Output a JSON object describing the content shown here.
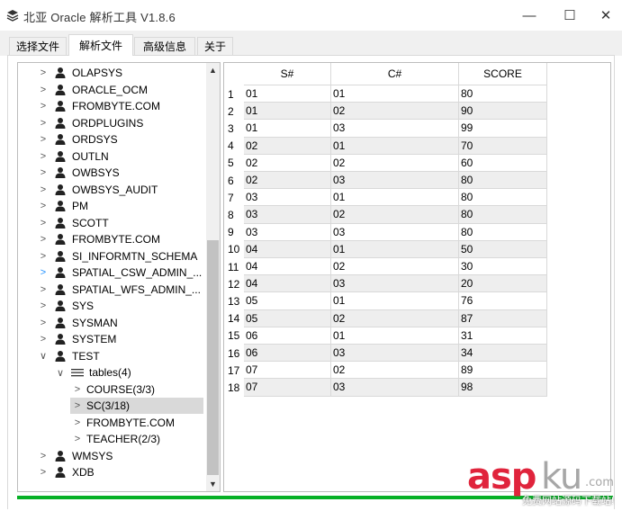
{
  "window": {
    "title": "北亚 Oracle 解析工具  V1.8.6",
    "minimize_glyph": "—",
    "maximize_glyph": "☐",
    "close_glyph": "✕",
    "icon": "layers-icon"
  },
  "tabs": [
    {
      "label": "选择文件",
      "active": false
    },
    {
      "label": "解析文件",
      "active": true
    },
    {
      "label": "高级信息",
      "active": false
    },
    {
      "label": "关于",
      "active": false
    }
  ],
  "tree": {
    "items": [
      {
        "label": "OLAPSYS",
        "type": "user",
        "chevron": ">"
      },
      {
        "label": "ORACLE_OCM",
        "type": "user",
        "chevron": ">"
      },
      {
        "label": "FROMBYTE.COM",
        "type": "user",
        "chevron": ">"
      },
      {
        "label": "ORDPLUGINS",
        "type": "user",
        "chevron": ">"
      },
      {
        "label": "ORDSYS",
        "type": "user",
        "chevron": ">"
      },
      {
        "label": "OUTLN",
        "type": "user",
        "chevron": ">"
      },
      {
        "label": "OWBSYS",
        "type": "user",
        "chevron": ">"
      },
      {
        "label": "OWBSYS_AUDIT",
        "type": "user",
        "chevron": ">"
      },
      {
        "label": "PM",
        "type": "user",
        "chevron": ">"
      },
      {
        "label": "SCOTT",
        "type": "user",
        "chevron": ">"
      },
      {
        "label": "FROMBYTE.COM",
        "type": "user",
        "chevron": ">"
      },
      {
        "label": "SI_INFORMTN_SCHEMA",
        "type": "user",
        "chevron": ">"
      },
      {
        "label": "SPATIAL_CSW_ADMIN_...",
        "type": "user",
        "chevron": ">",
        "hover": true
      },
      {
        "label": "SPATIAL_WFS_ADMIN_...",
        "type": "user",
        "chevron": ">"
      },
      {
        "label": "SYS",
        "type": "user",
        "chevron": ">"
      },
      {
        "label": "SYSMAN",
        "type": "user",
        "chevron": ">"
      },
      {
        "label": "SYSTEM",
        "type": "user",
        "chevron": ">"
      },
      {
        "label": "TEST",
        "type": "user",
        "chevron": "∨",
        "expanded": true
      },
      {
        "label": "tables(4)",
        "type": "folder",
        "chevron": "∨",
        "expanded": true,
        "level": 1
      },
      {
        "label": "COURSE(3/3)",
        "type": "table",
        "chevron": ">",
        "level": 2
      },
      {
        "label": "SC(3/18)",
        "type": "table",
        "chevron": ">",
        "level": 2,
        "selected": true
      },
      {
        "label": "FROMBYTE.COM",
        "type": "table",
        "chevron": ">",
        "level": 2
      },
      {
        "label": "TEACHER(2/3)",
        "type": "table",
        "chevron": ">",
        "level": 2
      },
      {
        "label": "WMSYS",
        "type": "user",
        "chevron": ">"
      },
      {
        "label": "XDB",
        "type": "user",
        "chevron": ">"
      }
    ],
    "scroll_up": "▲",
    "scroll_down": "▼"
  },
  "grid": {
    "columns": [
      "S#",
      "C#",
      "SCORE"
    ],
    "rows": [
      [
        "01",
        "01",
        "80"
      ],
      [
        "01",
        "02",
        "90"
      ],
      [
        "01",
        "03",
        "99"
      ],
      [
        "02",
        "01",
        "70"
      ],
      [
        "02",
        "02",
        "60"
      ],
      [
        "02",
        "03",
        "80"
      ],
      [
        "03",
        "01",
        "80"
      ],
      [
        "03",
        "02",
        "80"
      ],
      [
        "03",
        "03",
        "80"
      ],
      [
        "04",
        "01",
        "50"
      ],
      [
        "04",
        "02",
        "30"
      ],
      [
        "04",
        "03",
        "20"
      ],
      [
        "05",
        "01",
        "76"
      ],
      [
        "05",
        "02",
        "87"
      ],
      [
        "06",
        "01",
        "31"
      ],
      [
        "06",
        "03",
        "34"
      ],
      [
        "07",
        "02",
        "89"
      ],
      [
        "07",
        "03",
        "98"
      ]
    ]
  },
  "progress": {
    "fraction": 1.0,
    "color": "#06b025"
  },
  "watermark": {
    "asp": "asp",
    "ku": "ku",
    "com": ".com",
    "sub": "免费网站源码下载站!"
  }
}
